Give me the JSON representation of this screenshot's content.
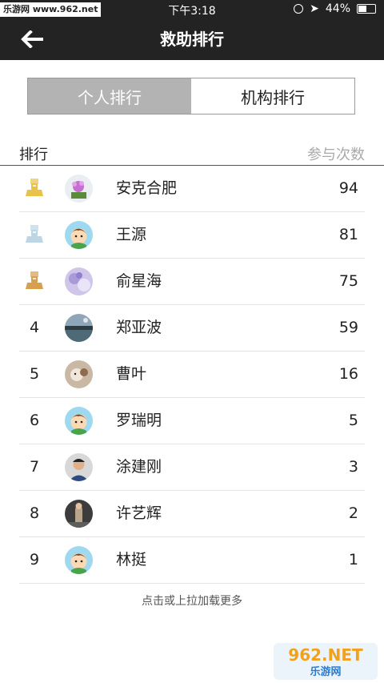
{
  "status_bar": {
    "site": "乐游网 www.962.net",
    "time": "下午3:18",
    "battery": "44%",
    "battery_level": 0.44
  },
  "nav": {
    "title": "救助排行",
    "back_icon": "arrow-left-icon"
  },
  "tabs": [
    {
      "label": "个人排行",
      "active": true
    },
    {
      "label": "机构排行",
      "active": false
    }
  ],
  "list_header": {
    "left": "排行",
    "right": "参与次数"
  },
  "rows": [
    {
      "rank": "",
      "medal": "gold",
      "name": "安克合肥",
      "count": "94",
      "avatar": "flower"
    },
    {
      "rank": "",
      "medal": "silver",
      "name": "王源",
      "count": "81",
      "avatar": "cartoon"
    },
    {
      "rank": "",
      "medal": "bronze",
      "name": "俞星海",
      "count": "75",
      "avatar": "purple"
    },
    {
      "rank": "4",
      "medal": "",
      "name": "郑亚波",
      "count": "59",
      "avatar": "landscape"
    },
    {
      "rank": "5",
      "medal": "",
      "name": "曹叶",
      "count": "16",
      "avatar": "pet"
    },
    {
      "rank": "6",
      "medal": "",
      "name": "罗瑞明",
      "count": "5",
      "avatar": "cartoon"
    },
    {
      "rank": "7",
      "medal": "",
      "name": "涂建刚",
      "count": "3",
      "avatar": "person"
    },
    {
      "rank": "8",
      "medal": "",
      "name": "许艺辉",
      "count": "2",
      "avatar": "dark"
    },
    {
      "rank": "9",
      "medal": "",
      "name": "林挺",
      "count": "1",
      "avatar": "cartoon"
    }
  ],
  "load_more": "点击或上拉加载更多",
  "watermark": {
    "line1": "962.NET",
    "line2": "乐游网"
  },
  "colors": {
    "bar": "#232323",
    "tab_active_bg": "#b3b3b3",
    "medal_gold": "#e8c24a",
    "medal_silver": "#bcd6e6",
    "medal_bronze": "#d7a04f"
  }
}
